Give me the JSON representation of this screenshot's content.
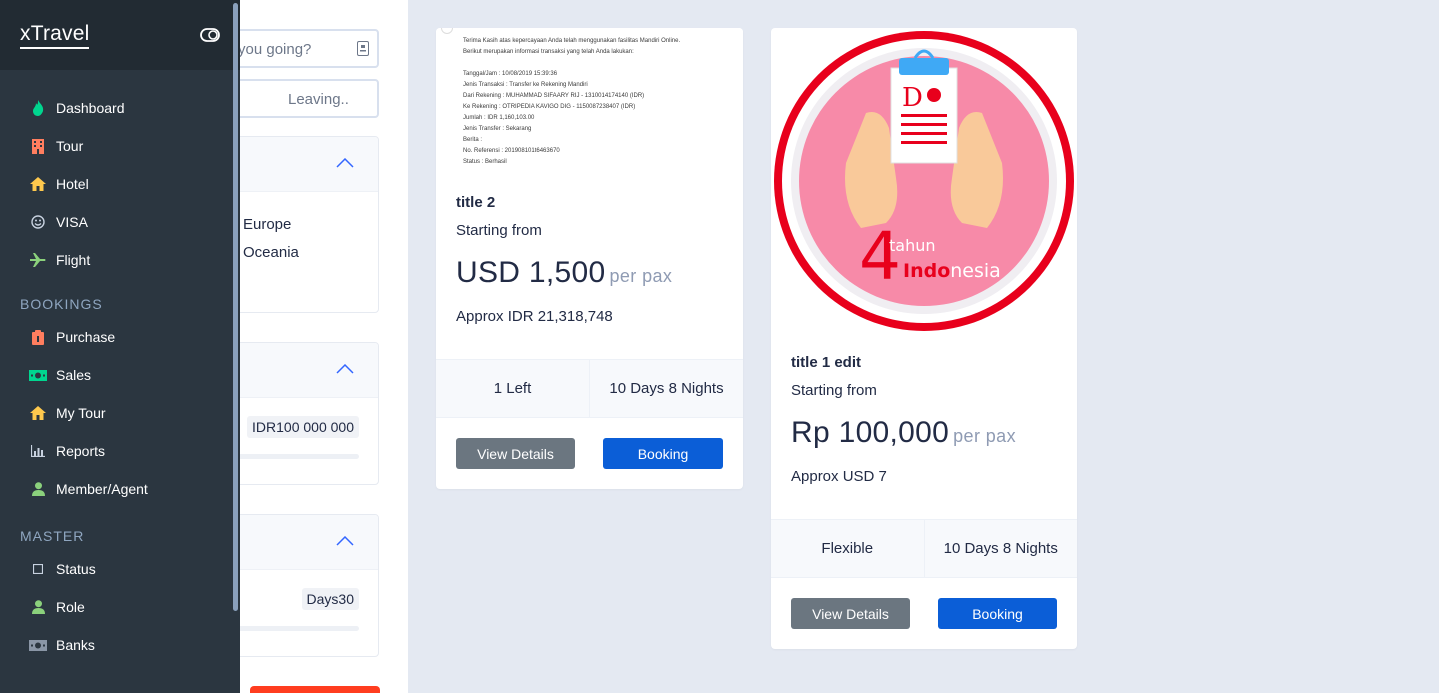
{
  "sidebar": {
    "brand": "xTravel",
    "items_main": [
      {
        "label": "Dashboard",
        "icon": "flame-icon"
      },
      {
        "label": "Tour",
        "icon": "building-icon"
      },
      {
        "label": "Hotel",
        "icon": "home-icon"
      },
      {
        "label": "VISA",
        "icon": "smiley-icon"
      },
      {
        "label": "Flight",
        "icon": "plane-icon"
      }
    ],
    "section_bookings": "BOOKINGS",
    "items_bookings": [
      {
        "label": "Purchase",
        "icon": "receipt-icon"
      },
      {
        "label": "Sales",
        "icon": "money-icon"
      },
      {
        "label": "My Tour",
        "icon": "home-icon"
      },
      {
        "label": "Reports",
        "icon": "bar-chart-icon"
      },
      {
        "label": "Member/Agent",
        "icon": "user-icon"
      }
    ],
    "section_master": "MASTER",
    "items_master": [
      {
        "label": "Status",
        "icon": "square-icon"
      },
      {
        "label": "Role",
        "icon": "user-icon"
      },
      {
        "label": "Banks",
        "icon": "money-icon"
      }
    ]
  },
  "filters": {
    "search_placeholder": "you going?",
    "leaving_placeholder": "Leaving..",
    "regions": [
      "Europe",
      "Oceania"
    ],
    "price_chip": "IDR100 000 000",
    "days_chip": "Days30"
  },
  "cards": [
    {
      "receipt_lines": [
        "Terima Kasih atas kepercayaan Anda telah menggunakan fasilitas Mandiri Online.",
        "Berikut merupakan informasi transaksi yang telah Anda lakukan:",
        "",
        "Tanggal/Jam            : 10/08/2019 15:39:36",
        "Jenis Transaksi        : Transfer ke Rekening Mandiri",
        "Dari Rekening          : MUHAMMAD SIFAARY RIJ - 1310014174140 (IDR)",
        "Ke Rekening            : OTRIPEDIA KAVIGO DIG - 1150087238407 (IDR)",
        "Jumlah                 : IDR 1,160,103.00",
        "Jenis Transfer         : Sekarang",
        "Berita                 :",
        "No. Referensi          : 201908101t6463670",
        "Status                 : Berhasil"
      ],
      "title": "title 2",
      "starting": "Starting from",
      "price": "USD 1,500",
      "unit": "per pax",
      "approx": "Approx IDR 21,318,748",
      "left": "1 Left",
      "duration": "10 Days 8 Nights",
      "view": "View Details",
      "booking": "Booking"
    },
    {
      "logo_number": "4",
      "logo_tahun": "tahun",
      "logo_indo": "Indo",
      "logo_nesia": "nesia",
      "logo_letter": "D",
      "title": "title 1 edit",
      "starting": "Starting from",
      "price": "Rp 100,000",
      "unit": "per pax",
      "approx": "Approx USD 7",
      "left": "Flexible",
      "duration": "10 Days 8 Nights",
      "view": "View Details",
      "booking": "Booking"
    }
  ],
  "colors": {
    "sidebar_bg": "#2b3640",
    "accent_blue": "#0b5ed7",
    "grey_button": "#6b7680",
    "logo_red": "#e8001c",
    "logo_pink": "#f78aa8"
  }
}
